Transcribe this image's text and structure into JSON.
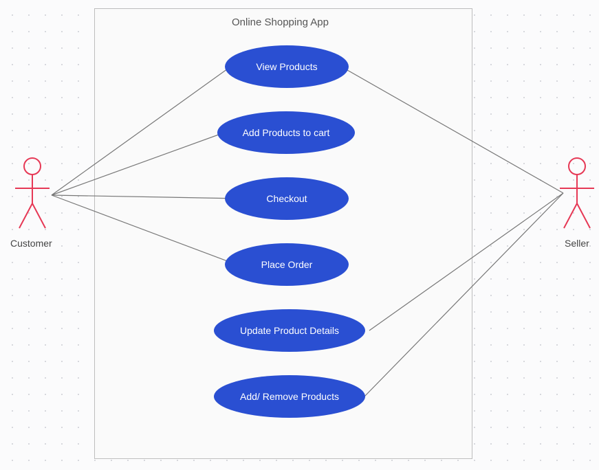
{
  "diagram": {
    "system_title": "Online Shopping App",
    "actors": {
      "left": "Customer",
      "right": "Seller"
    },
    "use_cases": [
      "View Products",
      "Add Products to cart",
      "Checkout",
      "Place Order",
      "Update Product Details",
      "Add/ Remove Products"
    ]
  }
}
